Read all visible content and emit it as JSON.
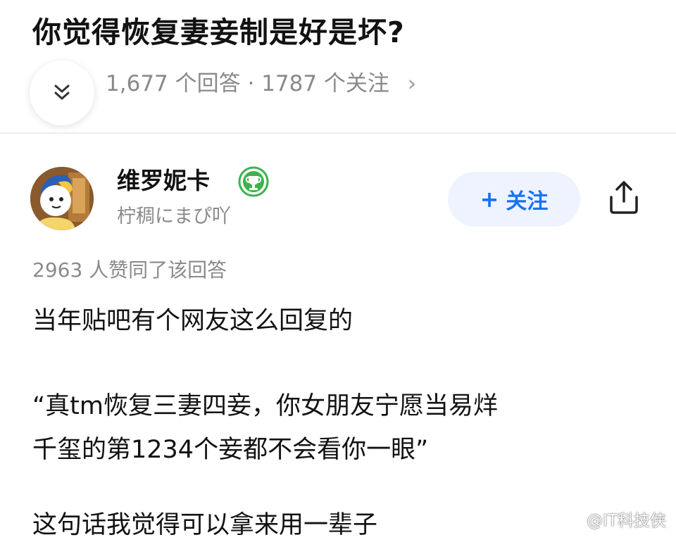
{
  "question": {
    "title": "你觉得恢复妻妾制是好是坏?",
    "answers_count": "1,677 个回答",
    "separator": "·",
    "followers_count": "1787 个关注",
    "more_chevron": "›",
    "expand_icon": "double-chevron-down-icon"
  },
  "author": {
    "name": "维罗妮卡",
    "badge_icon": "trophy-badge-icon",
    "badge_color": "#3db24b",
    "subtitle": "柠稠にまぴ吖",
    "follow_plus": "+",
    "follow_label": "关注",
    "share_icon": "share-icon"
  },
  "answer": {
    "upvotes": "2963 人赞同了该回答",
    "paragraphs": [
      "当年贴吧有个网友这么回复的",
      "“真tm恢复三妻四妾，你女朋友宁愿当易烊",
      "千玺的第1234个妾都不会看你一眼”",
      "这句话我觉得可以拿来用一辈子"
    ]
  },
  "watermark": {
    "text": "@IT科技侠",
    "icon": "weibo-icon"
  },
  "colors": {
    "accent": "#1772f6",
    "follow_bg": "#eef3ff",
    "muted_text": "#8a8a8a",
    "title_text": "#121212"
  }
}
